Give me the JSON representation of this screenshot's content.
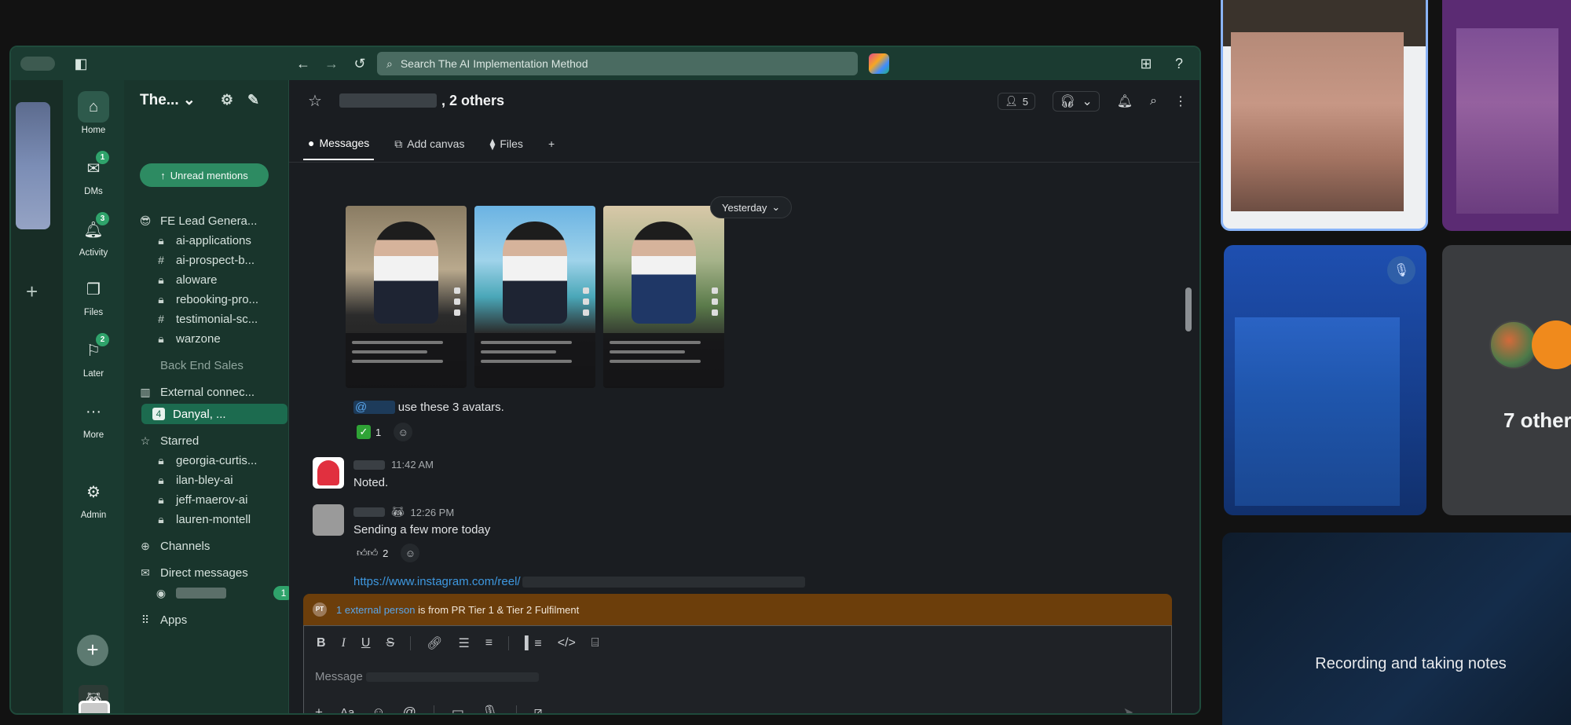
{
  "topbar": {
    "search_placeholder": "Search The AI Implementation Method"
  },
  "nav": {
    "home": "Home",
    "dms": "DMs",
    "dms_badge": "1",
    "activity": "Activity",
    "activity_badge": "3",
    "files": "Files",
    "later": "Later",
    "later_badge": "2",
    "more": "More",
    "admin": "Admin"
  },
  "sidebar": {
    "workspace": "The...",
    "unread_mentions": "Unread mentions",
    "group_name": "FE Lead Genera...",
    "channels": [
      {
        "icon": "lock",
        "name": "ai-applications"
      },
      {
        "icon": "hash",
        "name": "ai-prospect-b..."
      },
      {
        "icon": "lock",
        "name": "aloware"
      },
      {
        "icon": "lock",
        "name": "rebooking-pro..."
      },
      {
        "icon": "hash",
        "name": "testimonial-sc..."
      },
      {
        "icon": "lock",
        "name": "warzone"
      }
    ],
    "back_end_sales": "Back End Sales",
    "external_connections": "External connec...",
    "selected_dm": "Danyal, ...",
    "selected_dm_count": "4",
    "starred": "Starred",
    "starred_items": [
      "georgia-curtis...",
      "ilan-bley-ai",
      "jeff-maerov-ai",
      "lauren-montell"
    ],
    "channels_section": "Channels",
    "direct_messages": "Direct messages",
    "dm_badge": "1",
    "apps": "Apps"
  },
  "channel": {
    "name_suffix": ", 2 others",
    "member_count": "5",
    "tabs": [
      "Messages",
      "Add canvas",
      "Files"
    ]
  },
  "messages": {
    "date_divider": "Yesterday",
    "thumb_captions": [
      "The United States...",
      "",
      "Jews don't... time in"
    ],
    "msg1_text": "use these 3 avatars.",
    "msg1_reaction_count": "1",
    "msg2_time": "11:42 AM",
    "msg2_text": "Noted.",
    "msg3_time": "12:26 PM",
    "msg3_text": "Sending a few more today",
    "msg3_reaction_count": "2",
    "msg3_link": "https://www.instagram.com/reel/"
  },
  "composer": {
    "external_link": "1 external person",
    "external_text": " is from PR Tier 1 & Tier 2 Fulfilment",
    "placeholder": "Message"
  },
  "meeting": {
    "others_label": "7 other",
    "recording_text": "Recording and taking notes"
  },
  "colors": {
    "slack_topbar": "#1b3b31",
    "sidebar": "#19352c",
    "accent_green": "#2d8b62",
    "external_banner": "#6c3e0b",
    "link": "#3e98e0"
  }
}
